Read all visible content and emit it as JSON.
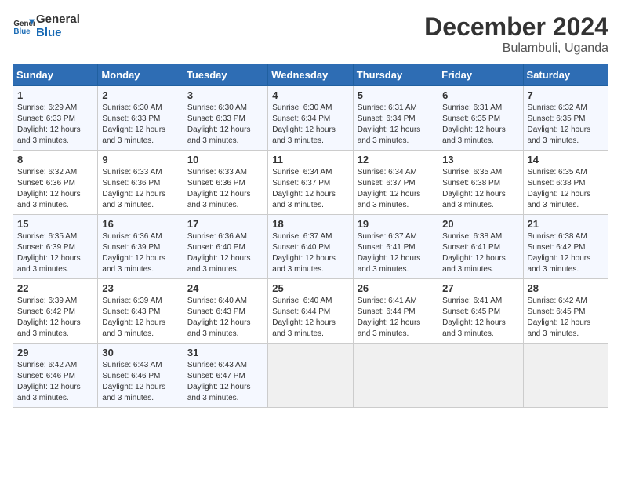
{
  "header": {
    "logo_line1": "General",
    "logo_line2": "Blue",
    "month_year": "December 2024",
    "location": "Bulambuli, Uganda"
  },
  "days_of_week": [
    "Sunday",
    "Monday",
    "Tuesday",
    "Wednesday",
    "Thursday",
    "Friday",
    "Saturday"
  ],
  "weeks": [
    [
      {
        "day": 1,
        "sunrise": "6:29 AM",
        "sunset": "6:33 PM",
        "daylight": "12 hours and 3 minutes."
      },
      {
        "day": 2,
        "sunrise": "6:30 AM",
        "sunset": "6:33 PM",
        "daylight": "12 hours and 3 minutes."
      },
      {
        "day": 3,
        "sunrise": "6:30 AM",
        "sunset": "6:33 PM",
        "daylight": "12 hours and 3 minutes."
      },
      {
        "day": 4,
        "sunrise": "6:30 AM",
        "sunset": "6:34 PM",
        "daylight": "12 hours and 3 minutes."
      },
      {
        "day": 5,
        "sunrise": "6:31 AM",
        "sunset": "6:34 PM",
        "daylight": "12 hours and 3 minutes."
      },
      {
        "day": 6,
        "sunrise": "6:31 AM",
        "sunset": "6:35 PM",
        "daylight": "12 hours and 3 minutes."
      },
      {
        "day": 7,
        "sunrise": "6:32 AM",
        "sunset": "6:35 PM",
        "daylight": "12 hours and 3 minutes."
      }
    ],
    [
      {
        "day": 8,
        "sunrise": "6:32 AM",
        "sunset": "6:36 PM",
        "daylight": "12 hours and 3 minutes."
      },
      {
        "day": 9,
        "sunrise": "6:33 AM",
        "sunset": "6:36 PM",
        "daylight": "12 hours and 3 minutes."
      },
      {
        "day": 10,
        "sunrise": "6:33 AM",
        "sunset": "6:36 PM",
        "daylight": "12 hours and 3 minutes."
      },
      {
        "day": 11,
        "sunrise": "6:34 AM",
        "sunset": "6:37 PM",
        "daylight": "12 hours and 3 minutes."
      },
      {
        "day": 12,
        "sunrise": "6:34 AM",
        "sunset": "6:37 PM",
        "daylight": "12 hours and 3 minutes."
      },
      {
        "day": 13,
        "sunrise": "6:35 AM",
        "sunset": "6:38 PM",
        "daylight": "12 hours and 3 minutes."
      },
      {
        "day": 14,
        "sunrise": "6:35 AM",
        "sunset": "6:38 PM",
        "daylight": "12 hours and 3 minutes."
      }
    ],
    [
      {
        "day": 15,
        "sunrise": "6:35 AM",
        "sunset": "6:39 PM",
        "daylight": "12 hours and 3 minutes."
      },
      {
        "day": 16,
        "sunrise": "6:36 AM",
        "sunset": "6:39 PM",
        "daylight": "12 hours and 3 minutes."
      },
      {
        "day": 17,
        "sunrise": "6:36 AM",
        "sunset": "6:40 PM",
        "daylight": "12 hours and 3 minutes."
      },
      {
        "day": 18,
        "sunrise": "6:37 AM",
        "sunset": "6:40 PM",
        "daylight": "12 hours and 3 minutes."
      },
      {
        "day": 19,
        "sunrise": "6:37 AM",
        "sunset": "6:41 PM",
        "daylight": "12 hours and 3 minutes."
      },
      {
        "day": 20,
        "sunrise": "6:38 AM",
        "sunset": "6:41 PM",
        "daylight": "12 hours and 3 minutes."
      },
      {
        "day": 21,
        "sunrise": "6:38 AM",
        "sunset": "6:42 PM",
        "daylight": "12 hours and 3 minutes."
      }
    ],
    [
      {
        "day": 22,
        "sunrise": "6:39 AM",
        "sunset": "6:42 PM",
        "daylight": "12 hours and 3 minutes."
      },
      {
        "day": 23,
        "sunrise": "6:39 AM",
        "sunset": "6:43 PM",
        "daylight": "12 hours and 3 minutes."
      },
      {
        "day": 24,
        "sunrise": "6:40 AM",
        "sunset": "6:43 PM",
        "daylight": "12 hours and 3 minutes."
      },
      {
        "day": 25,
        "sunrise": "6:40 AM",
        "sunset": "6:44 PM",
        "daylight": "12 hours and 3 minutes."
      },
      {
        "day": 26,
        "sunrise": "6:41 AM",
        "sunset": "6:44 PM",
        "daylight": "12 hours and 3 minutes."
      },
      {
        "day": 27,
        "sunrise": "6:41 AM",
        "sunset": "6:45 PM",
        "daylight": "12 hours and 3 minutes."
      },
      {
        "day": 28,
        "sunrise": "6:42 AM",
        "sunset": "6:45 PM",
        "daylight": "12 hours and 3 minutes."
      }
    ],
    [
      {
        "day": 29,
        "sunrise": "6:42 AM",
        "sunset": "6:46 PM",
        "daylight": "12 hours and 3 minutes."
      },
      {
        "day": 30,
        "sunrise": "6:43 AM",
        "sunset": "6:46 PM",
        "daylight": "12 hours and 3 minutes."
      },
      {
        "day": 31,
        "sunrise": "6:43 AM",
        "sunset": "6:47 PM",
        "daylight": "12 hours and 3 minutes."
      },
      null,
      null,
      null,
      null
    ]
  ]
}
